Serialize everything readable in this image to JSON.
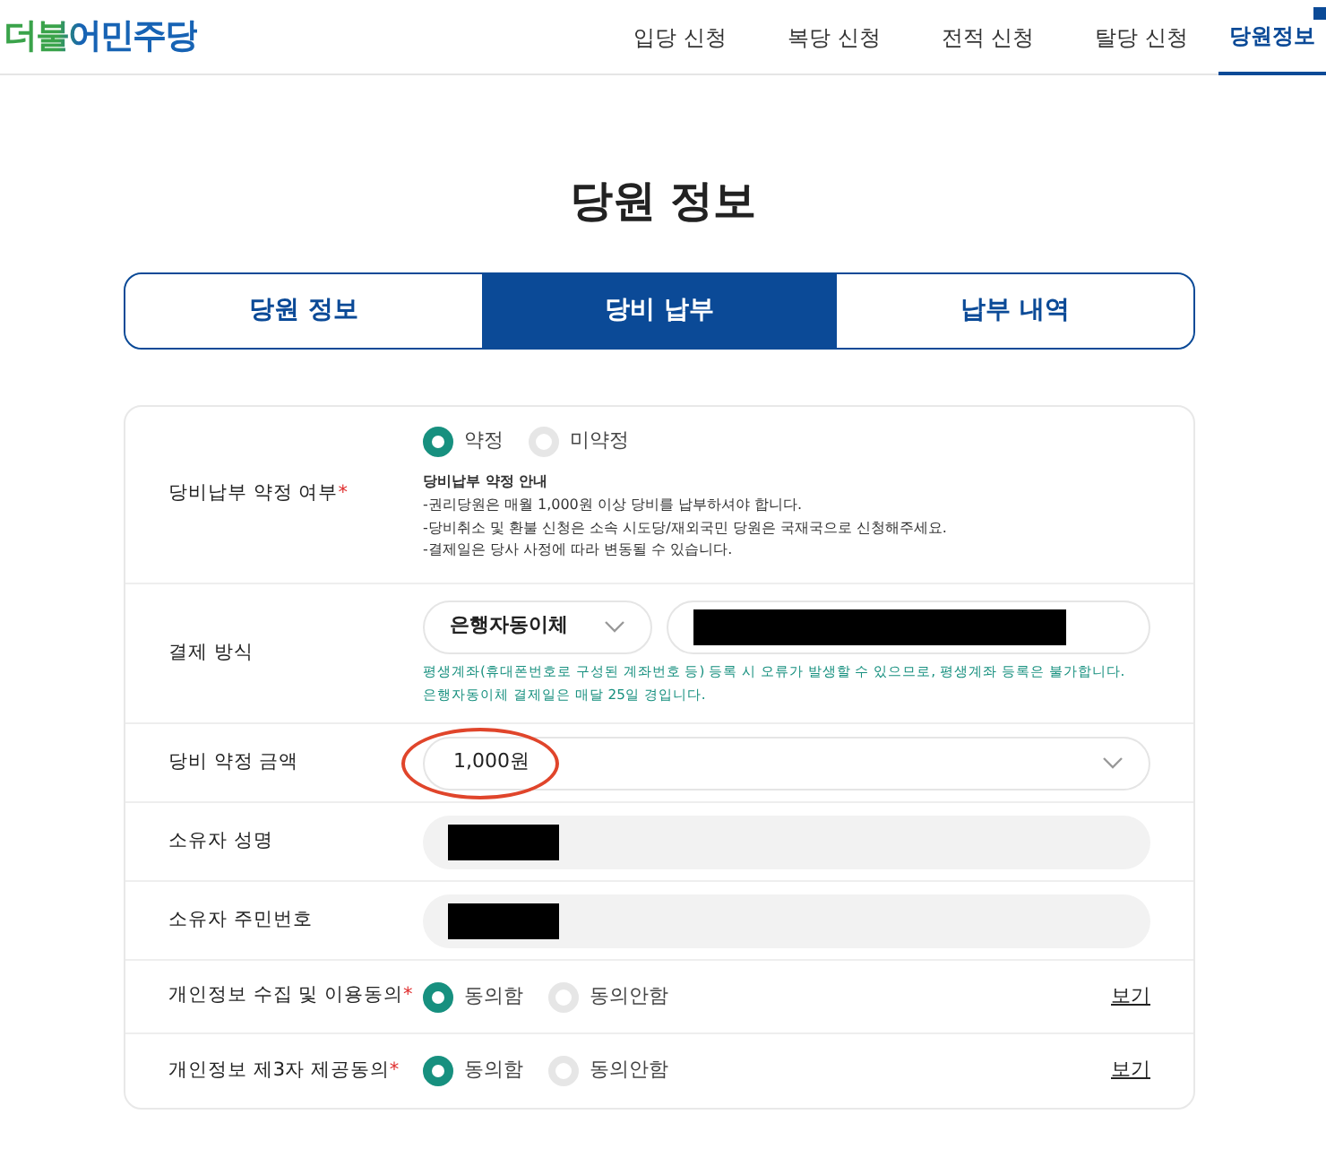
{
  "header": {
    "logo": "더불어민주당",
    "nav": [
      {
        "label": "입당 신청",
        "selected": false
      },
      {
        "label": "복당 신청",
        "selected": false
      },
      {
        "label": "전적 신청",
        "selected": false
      },
      {
        "label": "탈당 신청",
        "selected": false
      },
      {
        "label": "당원정보",
        "selected": true,
        "plus_mark": true
      }
    ]
  },
  "title": "당원 정보",
  "tabs": [
    {
      "label": "당원 정보",
      "selected": false
    },
    {
      "label": "당비 납부",
      "selected": true
    },
    {
      "label": "납부 내역",
      "selected": false
    }
  ],
  "form": [
    {
      "kind": "radio",
      "label": "당비납부 약정 여부",
      "required_mark": "*",
      "options": [
        {
          "label": "약정",
          "selected": true
        },
        {
          "label": "미약정",
          "selected": false
        }
      ],
      "note_title": "당비납부 약정 안내",
      "notes": [
        "-권리당원은 매월 1,000원 이상 당비를 납부하셔야 합니다.",
        "-당비취소 및 환불 신청은 소속 시도당/재외국민 당원은 국재국으로 신청해주세요.",
        "-결제일은 당사 사정에 따라 변동될 수 있습니다."
      ]
    },
    {
      "kind": "payment",
      "label": "결제 방식",
      "value": "은행자동이체",
      "redacted": true,
      "hints": [
        "평생계좌(휴대폰번호로 구성된 계좌번호 등) 등록 시 오류가 발생할 수 있으므로, 평생계좌 등록은 불가합니다.",
        "은행자동이체 결제일은 매달 25일 경입니다."
      ]
    },
    {
      "kind": "select",
      "label": "당비 약정 금액",
      "value": "1,000원",
      "circled": true
    },
    {
      "kind": "redacted",
      "label": "소유자 성명",
      "redacted": true
    },
    {
      "kind": "redacted",
      "label": "소유자 주민번호",
      "redacted": true
    },
    {
      "kind": "consent",
      "label": "개인정보 수집 및 이용동의",
      "required_mark": "*",
      "options": [
        {
          "label": "동의함",
          "selected": true
        },
        {
          "label": "동의안함",
          "selected": false
        }
      ],
      "link": "보기"
    },
    {
      "kind": "consent",
      "label": "개인정보 제3자 제공동의",
      "required_mark": "*",
      "options": [
        {
          "label": "동의함",
          "selected": true
        },
        {
          "label": "동의안함",
          "selected": false
        }
      ],
      "link": "보기"
    }
  ]
}
